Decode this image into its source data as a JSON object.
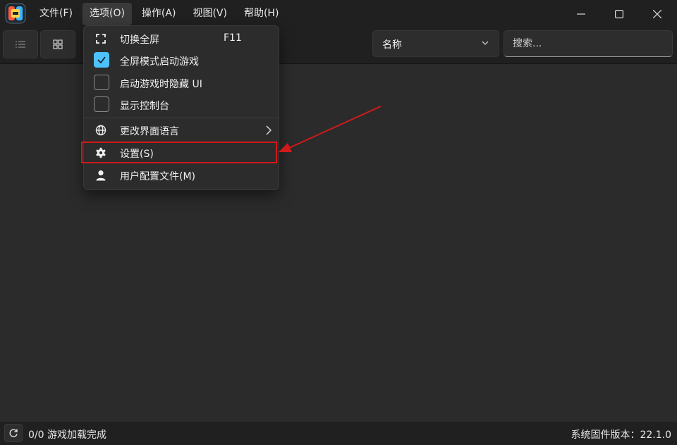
{
  "titlebar": {
    "menus": [
      {
        "label": "文件(F)"
      },
      {
        "label": "选项(O)"
      },
      {
        "label": "操作(A)"
      },
      {
        "label": "视图(V)"
      },
      {
        "label": "帮助(H)"
      }
    ]
  },
  "toolbar": {
    "list_view_icon": "list-icon",
    "grid_view_icon": "grid-icon",
    "sort_select_value": "名称",
    "search_placeholder": "搜索..."
  },
  "options_menu": {
    "items": [
      {
        "label": "切换全屏",
        "shortcut": "F11",
        "icon": "fullscreen-icon"
      },
      {
        "label": "全屏模式启动游戏",
        "checked": true
      },
      {
        "label": "启动游戏时隐藏 UI",
        "checked": false
      },
      {
        "label": "显示控制台",
        "checked": false
      },
      {
        "label": "更改界面语言",
        "icon": "globe-icon",
        "submenu": true
      },
      {
        "label": "设置(S)",
        "icon": "gear-icon",
        "highlighted": true
      },
      {
        "label": "用户配置文件(M)",
        "icon": "user-icon"
      }
    ]
  },
  "status": {
    "games_loaded": "0/0 游戏加载完成",
    "firmware": "系统固件版本：22.1.0"
  },
  "colors": {
    "accent": "#4cc2ff",
    "annotation": "#d01a1a",
    "background": "#2b2b2b",
    "bar": "#202020"
  }
}
